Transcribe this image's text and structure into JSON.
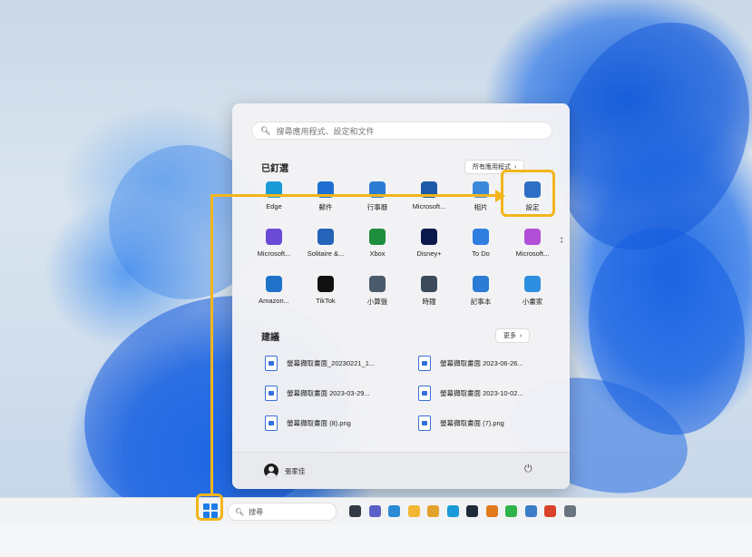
{
  "start_menu": {
    "search_placeholder": "搜尋應用程式、設定和文件",
    "pinned": {
      "title": "已釘選",
      "all_apps_label": "所有應用程式",
      "apps": [
        {
          "label": "Edge",
          "icon": "edge-icon",
          "color": "#1a9bd7"
        },
        {
          "label": "郵件",
          "icon": "mail-icon",
          "color": "#1f6fd2"
        },
        {
          "label": "行事曆",
          "icon": "calendar-icon",
          "color": "#2b7cd3"
        },
        {
          "label": "Microsoft...",
          "icon": "store-icon",
          "color": "#1e5aa8"
        },
        {
          "label": "相片",
          "icon": "photos-icon",
          "color": "#3b8ad9"
        },
        {
          "label": "設定",
          "icon": "settings-gear-icon",
          "color": "#2c6fc4"
        },
        {
          "label": "Microsoft...",
          "icon": "clipchamp-icon",
          "color": "#6a4bd6"
        },
        {
          "label": "Solitaire &...",
          "icon": "solitaire-icon",
          "color": "#2463b8"
        },
        {
          "label": "Xbox",
          "icon": "xbox-icon",
          "color": "#1e8e3e"
        },
        {
          "label": "Disney+",
          "icon": "disney-icon",
          "color": "#0b1a4a"
        },
        {
          "label": "To Do",
          "icon": "todo-check-icon",
          "color": "#2f7ee0"
        },
        {
          "label": "Microsoft...",
          "icon": "office-icon",
          "color": "#b14fd6"
        },
        {
          "label": "Amazon...",
          "icon": "amazon-icon",
          "color": "#1f72c8"
        },
        {
          "label": "TikTok",
          "icon": "tiktok-icon",
          "color": "#111111"
        },
        {
          "label": "小算盤",
          "icon": "calculator-icon",
          "color": "#4a5a6a"
        },
        {
          "label": "時鐘",
          "icon": "clock-icon",
          "color": "#3d4a5a"
        },
        {
          "label": "記事本",
          "icon": "notepad-icon",
          "color": "#2b7cd3"
        },
        {
          "label": "小畫家",
          "icon": "paint-icon",
          "color": "#2e8fe0"
        }
      ]
    },
    "recommended": {
      "title": "建議",
      "more_label": "更多",
      "items": [
        "螢幕擷取畫面_20230221_1...",
        "螢幕擷取畫面 2023-06-26...",
        "螢幕擷取畫面 2023-03-29...",
        "螢幕擷取畫面 2023-10-02...",
        "螢幕擷取畫面 (8).png",
        "螢幕擷取畫面 (7).png"
      ]
    },
    "user_name": "張家佳"
  },
  "taskbar": {
    "search_label": "搜尋",
    "icons": [
      {
        "name": "task-view-icon",
        "color": "#333a44"
      },
      {
        "name": "chat-icon",
        "color": "#5b5fc7"
      },
      {
        "name": "widgets-icon",
        "color": "#2a8ad4"
      },
      {
        "name": "file-explorer-icon",
        "color": "#f2b632"
      },
      {
        "name": "chrome-icon",
        "color": "#e2a22a"
      },
      {
        "name": "edge-taskbar-icon",
        "color": "#1a9bd7"
      },
      {
        "name": "app-icon-dark",
        "color": "#1e2a3a"
      },
      {
        "name": "app-icon-orange",
        "color": "#e07a1a"
      },
      {
        "name": "line-icon",
        "color": "#2fb44a"
      },
      {
        "name": "app-icon-blue",
        "color": "#3a7cc8"
      },
      {
        "name": "app-icon-red",
        "color": "#d9432b"
      },
      {
        "name": "app-icon-gray",
        "color": "#6a7480"
      }
    ]
  },
  "colors": {
    "highlight": "#f3b51b",
    "accent": "#1e7be8"
  }
}
